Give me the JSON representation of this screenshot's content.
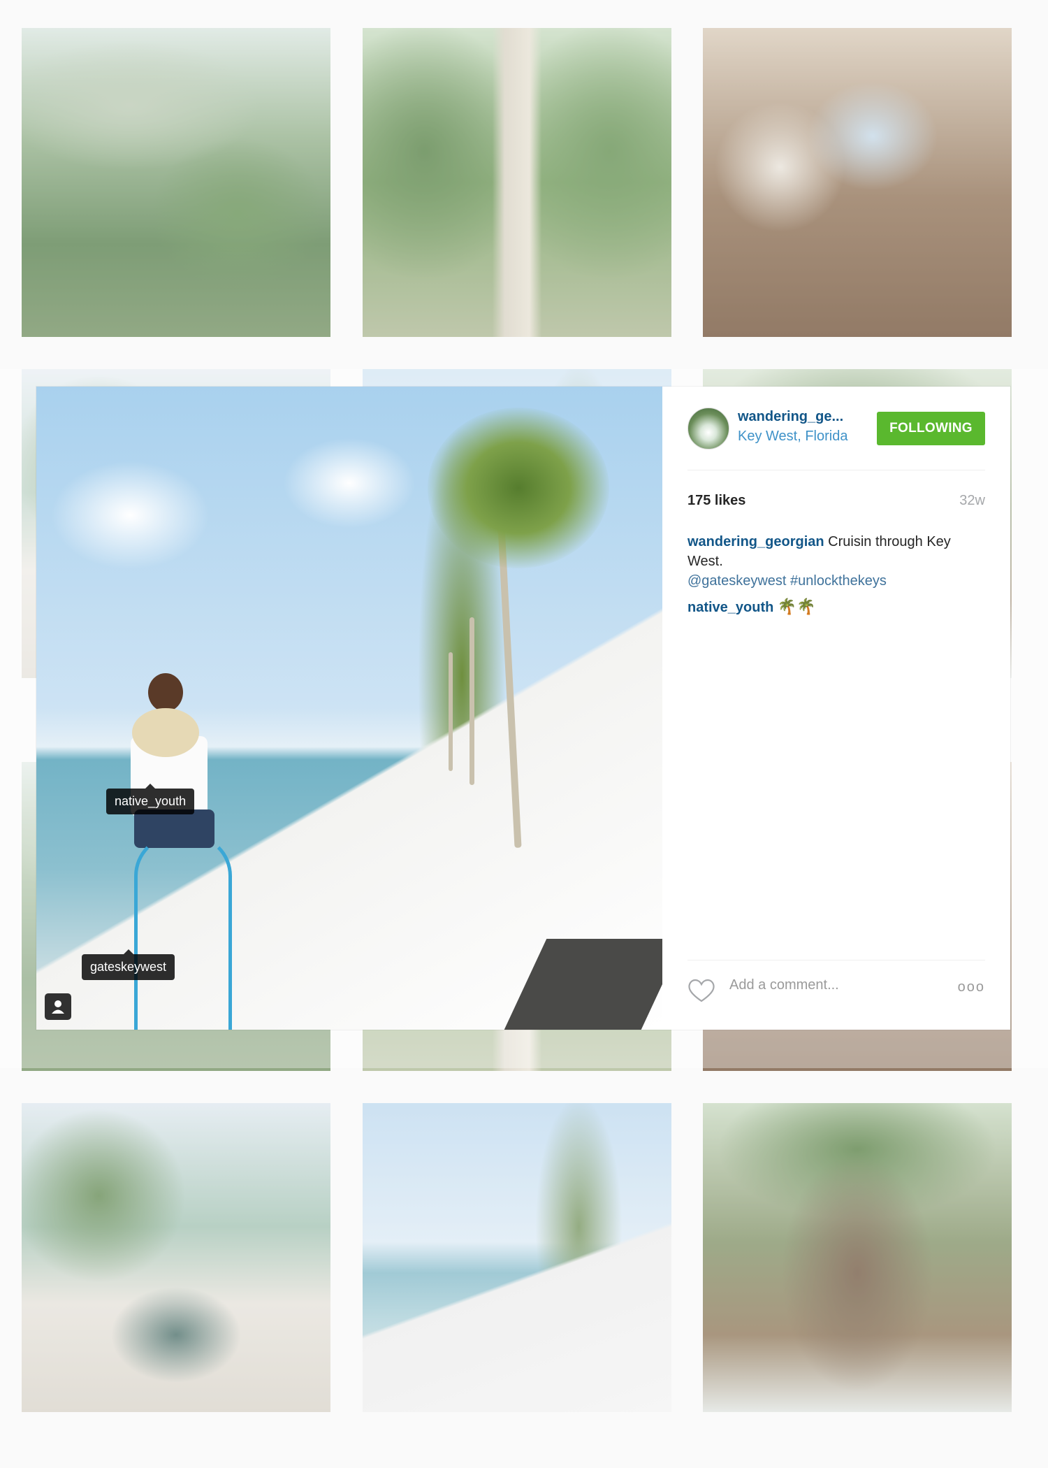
{
  "grid": {
    "tiles": [
      {
        "name": "grid-photo-moss-trees"
      },
      {
        "name": "grid-photo-trail-walk"
      },
      {
        "name": "grid-photo-cigar-rolling"
      },
      {
        "name": "grid-photo-bike-row2-left"
      },
      {
        "name": "grid-photo-bike-row2-mid"
      },
      {
        "name": "grid-photo-bike-row2-right"
      },
      {
        "name": "grid-photo-vintage-car"
      },
      {
        "name": "grid-photo-bike-seawall"
      },
      {
        "name": "grid-photo-banyan-tree"
      }
    ]
  },
  "post": {
    "photo_tags": {
      "tag1": "native_youth",
      "tag2": "gateskeywest"
    },
    "header": {
      "username": "wandering_ge...",
      "location": "Key West, Florida",
      "follow_label": "FOLLOWING"
    },
    "likes": "175 likes",
    "age": "32w",
    "caption": {
      "author": "wandering_georgian",
      "text": " Cruisin through Key West.",
      "mention": "@gateskeywest",
      "hashtag": "#unlockthekeys"
    },
    "comment": {
      "author": "native_youth",
      "emoji": "🌴🌴"
    },
    "footer": {
      "comment_placeholder": "Add a comment...",
      "more_label": "ooo"
    }
  },
  "colors": {
    "link": "#125688",
    "location": "#3f92c8",
    "follow_button": "#5ab82e",
    "muted": "#a5a7aa"
  },
  "icons": [
    "heart-icon",
    "user-tag-icon",
    "more-options-icon"
  ]
}
